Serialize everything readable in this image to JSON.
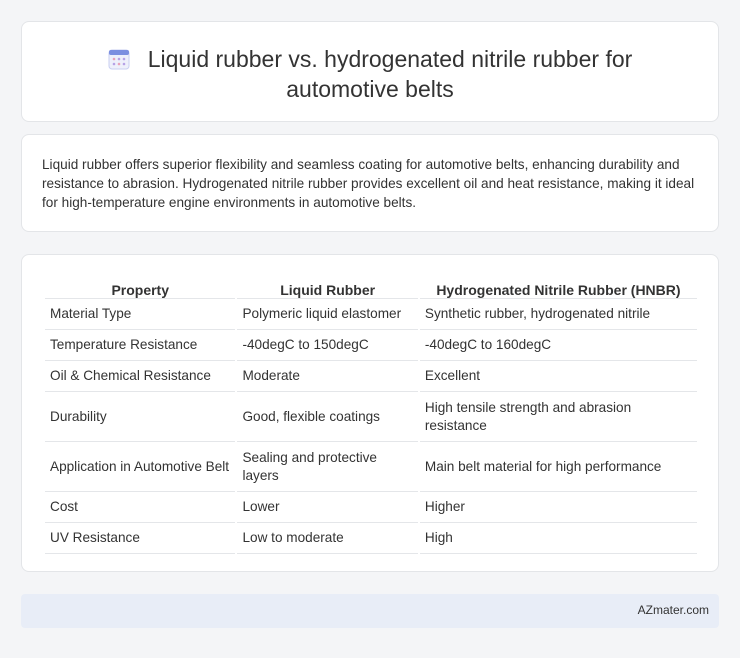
{
  "header": {
    "title_line1": "Liquid rubber vs. hydrogenated nitrile rubber for",
    "title_line2": "automotive belts",
    "icon": "calendar-icon"
  },
  "intro": {
    "text": "Liquid rubber offers superior flexibility and seamless coating for automotive belts, enhancing durability and resistance to abrasion. Hydrogenated nitrile rubber provides excellent oil and heat resistance, making it ideal for high-temperature engine environments in automotive belts."
  },
  "table": {
    "headers": [
      "Property",
      "Liquid Rubber",
      "Hydrogenated Nitrile Rubber (HNBR)"
    ],
    "rows": [
      [
        "Material Type",
        "Polymeric liquid elastomer",
        "Synthetic rubber, hydrogenated nitrile"
      ],
      [
        "Temperature Resistance",
        "-40degC to 150degC",
        "-40degC to 160degC"
      ],
      [
        "Oil & Chemical Resistance",
        "Moderate",
        "Excellent"
      ],
      [
        "Durability",
        "Good, flexible coatings",
        "High tensile strength and abrasion resistance"
      ],
      [
        "Application in Automotive Belt",
        "Sealing and protective layers",
        "Main belt material for high performance"
      ],
      [
        "Cost",
        "Lower",
        "Higher"
      ],
      [
        "UV Resistance",
        "Low to moderate",
        "High"
      ]
    ]
  },
  "footer": {
    "brand": "AZmater.com"
  },
  "colors": {
    "background": "#f4f5f7",
    "card": "#ffffff",
    "footer_bg": "#e8edf7",
    "icon_accent": "#7b8fe0"
  }
}
